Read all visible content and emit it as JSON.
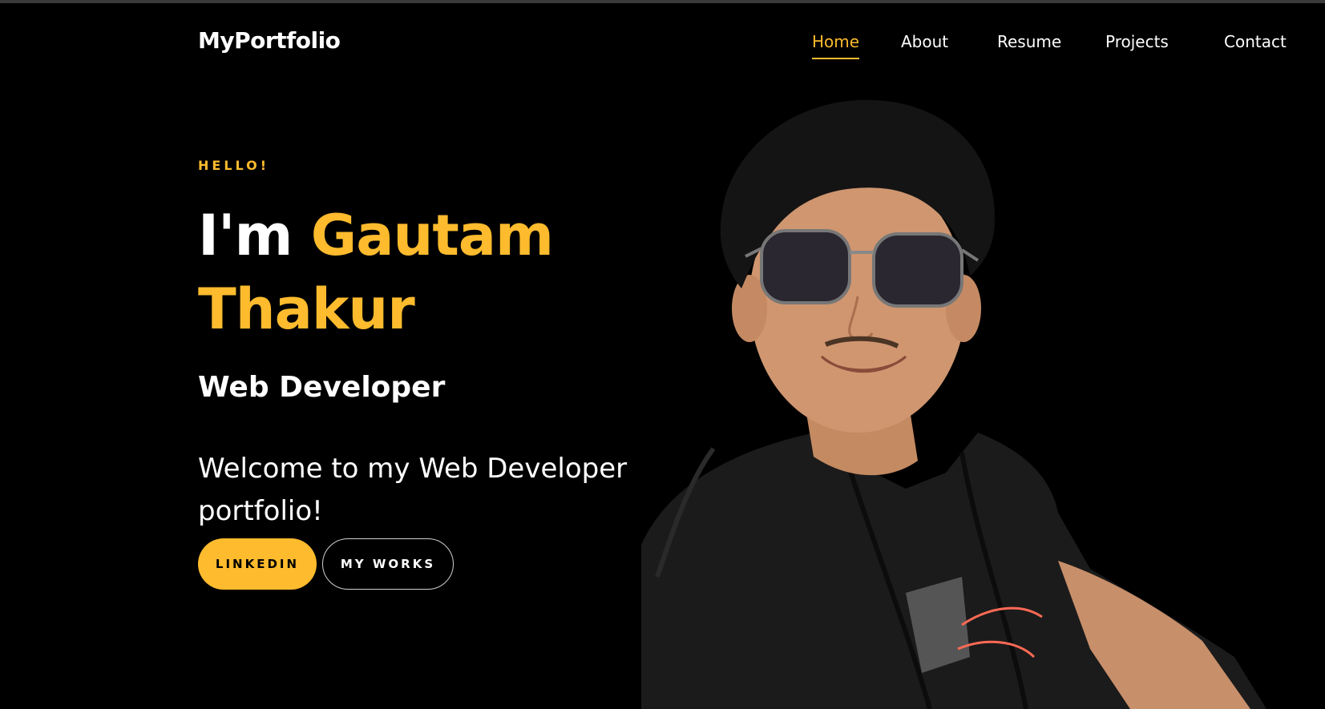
{
  "header": {
    "brand": "MyPortfolio",
    "nav": [
      {
        "label": "Home",
        "active": true
      },
      {
        "label": "About",
        "active": false
      },
      {
        "label": "Resume",
        "active": false
      },
      {
        "label": "Projects",
        "active": false
      },
      {
        "label": "Contact",
        "active": false
      }
    ]
  },
  "hero": {
    "eyebrow": "HELLO!",
    "headline_prefix": "I'm ",
    "name_line1": "Gautam",
    "name_line2": "Thakur",
    "role": "Web Developer",
    "welcome": "Welcome to my Web Developer portfolio!",
    "buttons": {
      "linkedin": "LINKEDIN",
      "works": "MY WORKS"
    }
  },
  "colors": {
    "accent": "#fdbb2d",
    "background": "#000000",
    "text": "#ffffff"
  },
  "icons": {
    "profile_photo": "portrait-photo"
  }
}
